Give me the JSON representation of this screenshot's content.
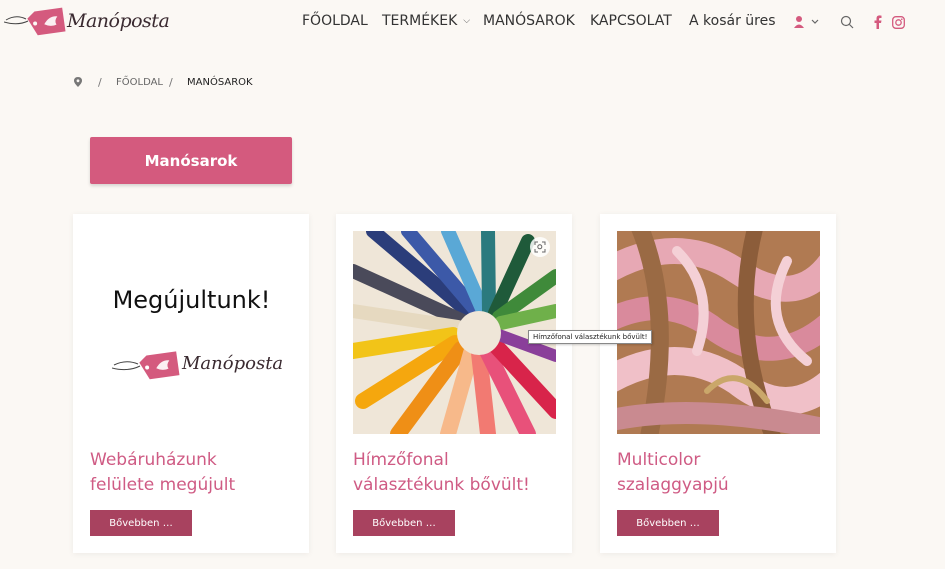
{
  "header": {
    "logo_text": "Manóposta",
    "nav": [
      {
        "label": "FŐOLDAL"
      },
      {
        "label": "TERMÉKEK",
        "has_dropdown": true
      },
      {
        "label": "MANÓSAROK"
      },
      {
        "label": "KAPCSOLAT"
      },
      {
        "label": "A kosár üres"
      }
    ],
    "icons": [
      "user-icon",
      "search-icon",
      "facebook-icon",
      "instagram-icon"
    ]
  },
  "breadcrumb": {
    "items": [
      "FŐOLDAL",
      "MANÓSAROK"
    ],
    "separator": "/"
  },
  "page_title": "Manósarok",
  "cards": [
    {
      "title_line1": "Webáruházunk",
      "title_line2": "felülete megújult",
      "image_text": "Megújultunk!",
      "image_logo": "Manóposta",
      "button": "Bővebben …"
    },
    {
      "title_line1": "Hímzőfonal",
      "title_line2": "választékunk bővült!",
      "tooltip": "Hímzőfonal választékunk bővült!",
      "button": "Bővebben …"
    },
    {
      "title_line1": "Multicolor",
      "title_line2": "szalaggyapjú",
      "button": "Bővebben …"
    }
  ],
  "colors": {
    "accent": "#d45a7e",
    "button_dark": "#a8425f",
    "title_pink": "#cf5b84",
    "background": "#fbf8f4"
  }
}
